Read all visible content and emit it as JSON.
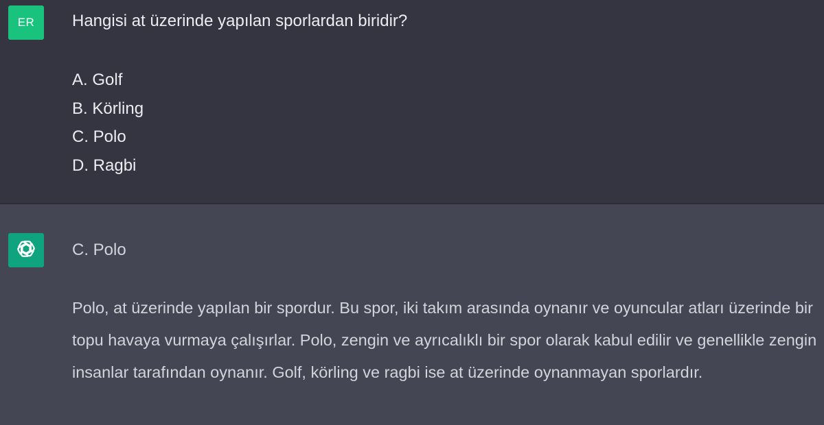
{
  "user_message": {
    "avatar_initials": "ER",
    "question": "Hangisi at üzerinde yapılan sporlardan biridir?",
    "options": [
      "A. Golf",
      "B. Körling",
      "C. Polo",
      "D. Ragbi"
    ]
  },
  "assistant_message": {
    "avatar_icon": "openai-logo-icon",
    "answer": "C. Polo",
    "explanation": "Polo, at üzerinde yapılan bir spordur. Bu spor, iki takım arasında oynanır ve oyuncular atları üzerinde bir topu havaya vurmaya çalışırlar. Polo, zengin ve ayrıcalıklı bir spor olarak kabul edilir ve genellikle zengin insanlar tarafından oynanır. Golf, körling ve ragbi ise at üzerinde oynanmayan sporlardır."
  },
  "colors": {
    "user_bg": "#343541",
    "assistant_bg": "#444654",
    "user_avatar": "#19c37d",
    "assistant_avatar": "#10a37f",
    "text": "#ececf1"
  }
}
